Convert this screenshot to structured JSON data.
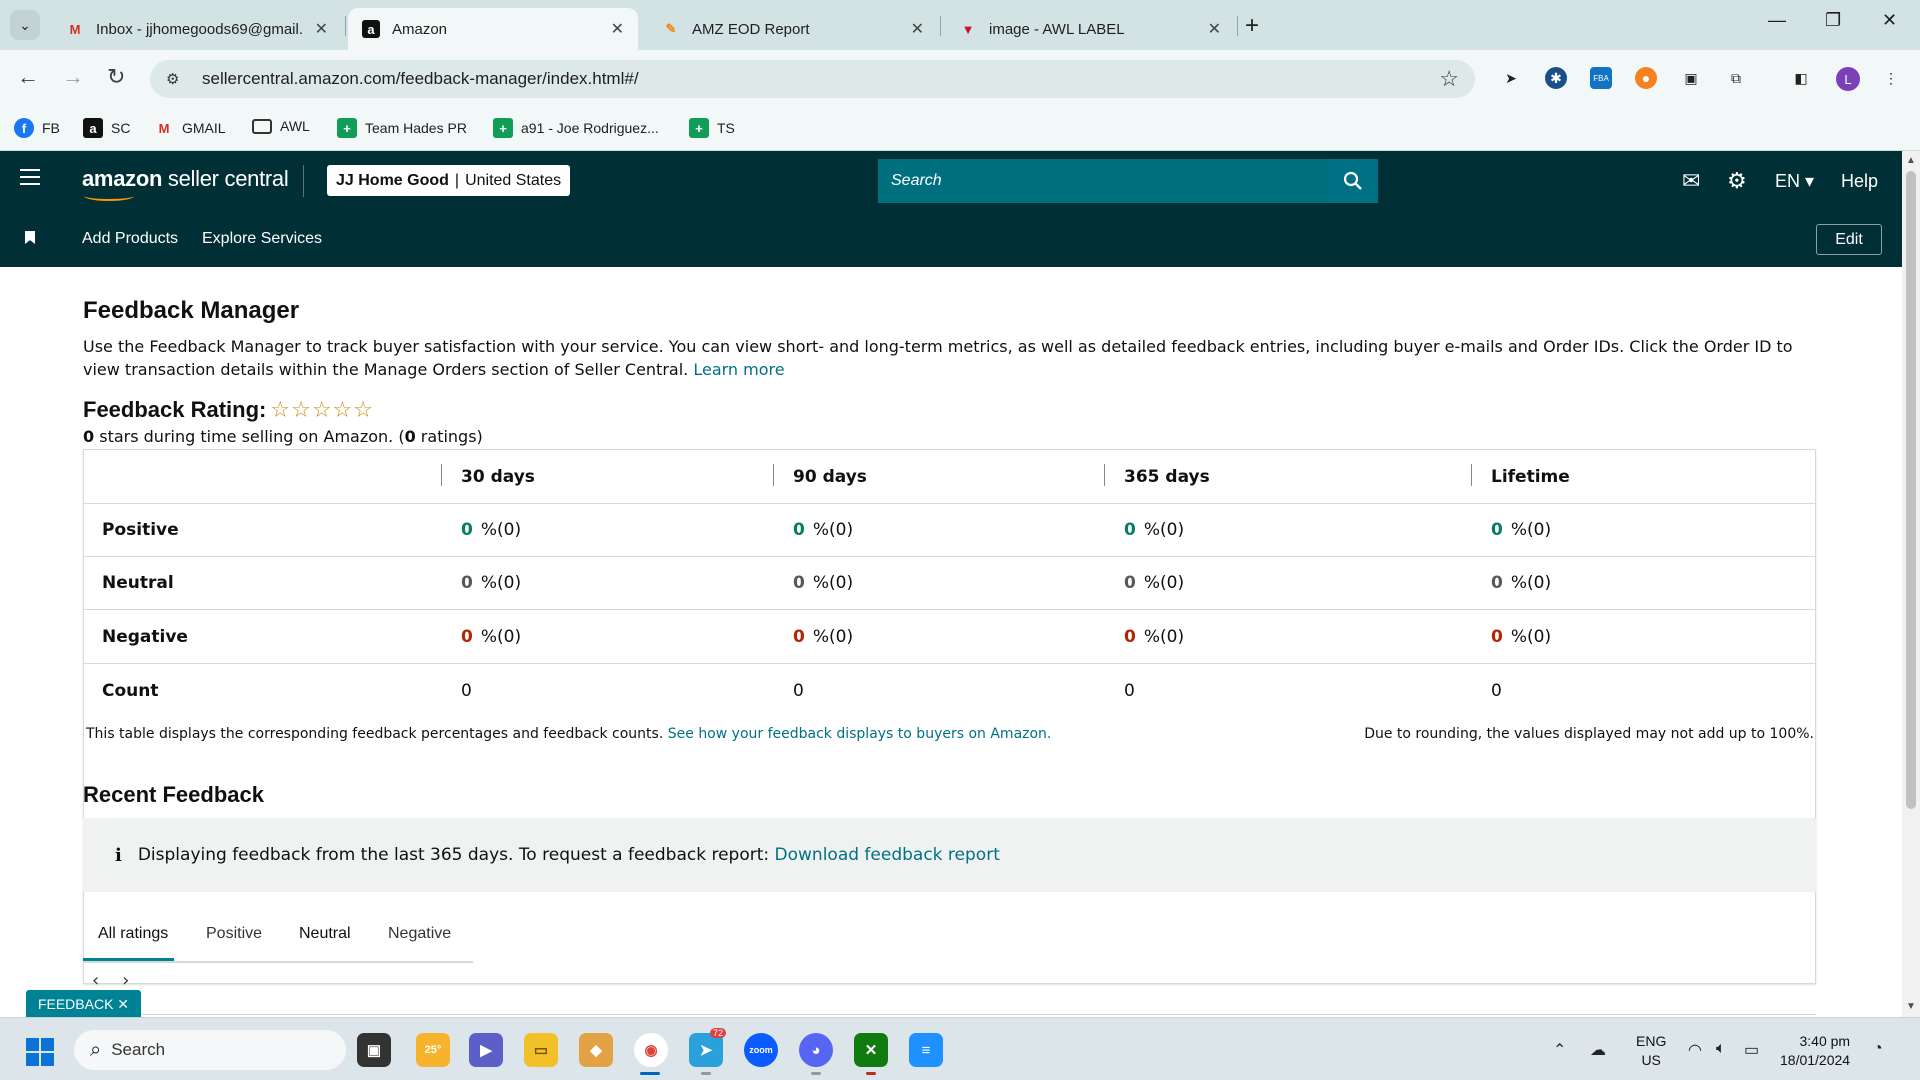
{
  "browser": {
    "tabs": [
      {
        "title": "Inbox - jjhomegoods69@gmail.",
        "favicon": "gmail-icon"
      },
      {
        "title": "Amazon",
        "favicon": "amazon-icon"
      },
      {
        "title": "AMZ EOD Report",
        "favicon": "docs-icon"
      },
      {
        "title": "image - AWL LABEL",
        "favicon": "awl-icon"
      }
    ],
    "url": "sellercentral.amazon.com/feedback-manager/index.html#/",
    "bookmarks": [
      "FB",
      "SC",
      "GMAIL",
      "AWL",
      "Team Hades PR",
      "a91 - Joe Rodriguez...",
      "TS"
    ],
    "profile_initial": "L",
    "ext_fba": "FBA"
  },
  "header": {
    "logo_bold": "amazon",
    "logo_rest": " seller central",
    "account_name": "JJ Home Good",
    "account_divider": "|",
    "account_region": "United States",
    "search_placeholder": "Search",
    "language": "EN",
    "help": "Help",
    "nav": [
      "Add Products",
      "Explore Services"
    ],
    "edit": "Edit"
  },
  "page": {
    "title": "Feedback Manager",
    "intro": "Use the Feedback Manager to track buyer satisfaction with your service. You can view short- and long-term metrics, as well as detailed feedback entries, including buyer e-mails and Order IDs. Click the Order ID to view transaction details within the Manage Orders section of Seller Central.",
    "learn_more": "Learn more",
    "rating_label": "Feedback Rating:",
    "stars": "☆☆☆☆☆",
    "rating_stars_value": "0",
    "rating_sub_mid": " stars during time selling on Amazon. (",
    "rating_count": "0",
    "rating_sub_end": " ratings)",
    "table": {
      "headers": [
        "30 days",
        "90 days",
        "365 days",
        "Lifetime"
      ],
      "rows": [
        {
          "label": "Positive",
          "values": [
            "0",
            "0",
            "0",
            "0"
          ],
          "suffix": "%(0)"
        },
        {
          "label": "Neutral",
          "values": [
            "0",
            "0",
            "0",
            "0"
          ],
          "suffix": "%(0)"
        },
        {
          "label": "Negative",
          "values": [
            "0",
            "0",
            "0",
            "0"
          ],
          "suffix": "%(0)"
        },
        {
          "label": "Count",
          "values": [
            "0",
            "0",
            "0",
            "0"
          ]
        }
      ]
    },
    "note_left": "This table displays the corresponding feedback percentages and feedback counts.",
    "note_link": "See how your feedback displays to buyers on Amazon.",
    "note_right": "Due to rounding, the values displayed may not add up to 100%.",
    "recent_title": "Recent Feedback",
    "info_text": "Displaying feedback from the last 365 days. To request a feedback report:",
    "info_link": "Download feedback report",
    "rating_tabs": [
      "All ratings",
      "Positive",
      "Neutral",
      "Negative"
    ],
    "feedback_button": "FEEDBACK ✕"
  },
  "taskbar": {
    "search": "Search",
    "weather": "25°",
    "telegram_badge": "72",
    "lang_top": "ENG",
    "lang_bottom": "US",
    "time": "3:40 pm",
    "date": "18/01/2024"
  }
}
